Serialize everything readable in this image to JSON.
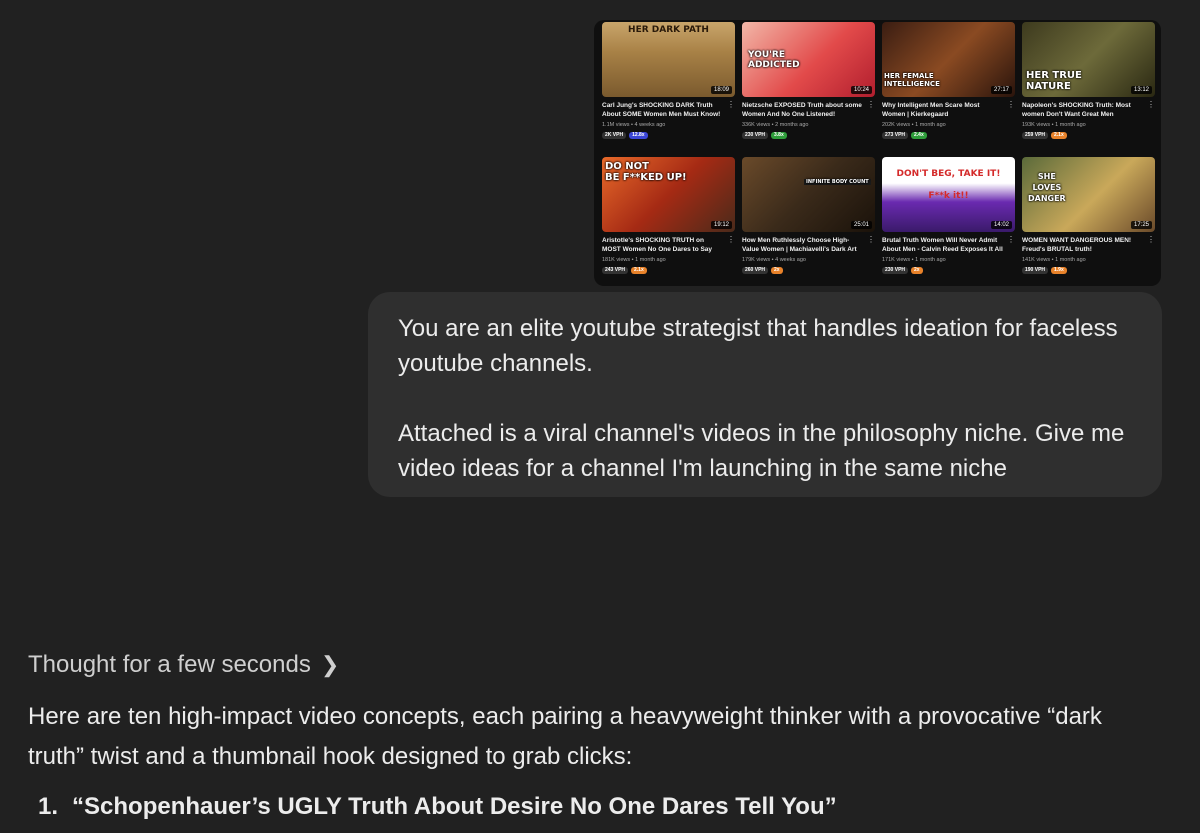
{
  "attachment": {
    "videos": [
      {
        "thumb_text": "HER DARK PATH",
        "duration": "18:09",
        "title": "Carl Jung's SHOCKING DARK Truth About SOME Women Men Must Know!",
        "meta": "1.1M views • 4 weeks ago",
        "vph": "2K VPH",
        "ratio": "12.8x",
        "ratio_color": "#3b46d6"
      },
      {
        "thumb_text": "YOU'RE\nADDICTED",
        "duration": "10:24",
        "title": "Nietzsche EXPOSED Truth about some Women And No One Listened!",
        "meta": "336K views • 2 months ago",
        "vph": "230 VPH",
        "ratio": "3.8x",
        "ratio_color": "#2e9d3a"
      },
      {
        "thumb_text": "HER FEMALE\nINTELLIGENCE",
        "duration": "27:17",
        "title": "Why Intelligent Men Scare Most Women | Kierkegaard",
        "meta": "202K views • 1 month ago",
        "vph": "273 VPH",
        "ratio": "2.4x",
        "ratio_color": "#2e9d3a"
      },
      {
        "thumb_text": "HER TRUE\nNATURE",
        "duration": "13:12",
        "title": "Napoleon's SHOCKING Truth: Most women Don't Want Great Men",
        "meta": "193K views • 1 month ago",
        "vph": "259 VPH",
        "ratio": "2.1x",
        "ratio_color": "#e8822a"
      },
      {
        "thumb_text": "DO NOT\nBE F**KED UP!",
        "duration": "19:12",
        "title": "Aristotle's SHOCKING TRUTH on MOST Women No One Dares to Say",
        "meta": "181K views • 1 month ago",
        "vph": "243 VPH",
        "ratio": "2.1x",
        "ratio_color": "#e8822a"
      },
      {
        "thumb_text": "INFINITE BODY COUNT",
        "duration": "25:01",
        "title": "How Men Ruthlessly Choose High-Value Women | Machiavelli's Dark Art",
        "meta": "179K views • 4 weeks ago",
        "vph": "260 VPH",
        "ratio": "2x",
        "ratio_color": "#e8822a"
      },
      {
        "thumb_text": "DON'T BEG, TAKE IT!\nF**k it!!",
        "duration": "14:02",
        "title": "Brutal Truth Women Will Never Admit About Men - Calvin Reed Exposes It All",
        "meta": "171K views • 1 month ago",
        "vph": "230 VPH",
        "ratio": "2x",
        "ratio_color": "#e8822a"
      },
      {
        "thumb_text": "SHE\nLOVES\nDANGER",
        "duration": "17:25",
        "title": "WOMEN WANT DANGEROUS MEN! Freud's BRUTAL truth!",
        "meta": "141K views • 1 month ago",
        "vph": "190 VPH",
        "ratio": "1.9x",
        "ratio_color": "#e8822a"
      }
    ]
  },
  "user_message": {
    "paragraph1": "You are an elite youtube strategist that handles ideation for faceless youtube channels.",
    "paragraph2": "Attached is a viral channel's videos in the philosophy niche. Give me video ideas for a channel I'm launching in the same niche"
  },
  "assistant": {
    "thought_label": "Thought for a few seconds",
    "intro": "Here are ten high-impact video concepts, each pairing a heavyweight thinker with a provocative “dark truth” twist and a thumbnail hook designed to grab clicks:",
    "first_item_number": "1.",
    "first_item": "“Schopenhauer’s UGLY Truth About Desire No One Dares Tell You”"
  }
}
